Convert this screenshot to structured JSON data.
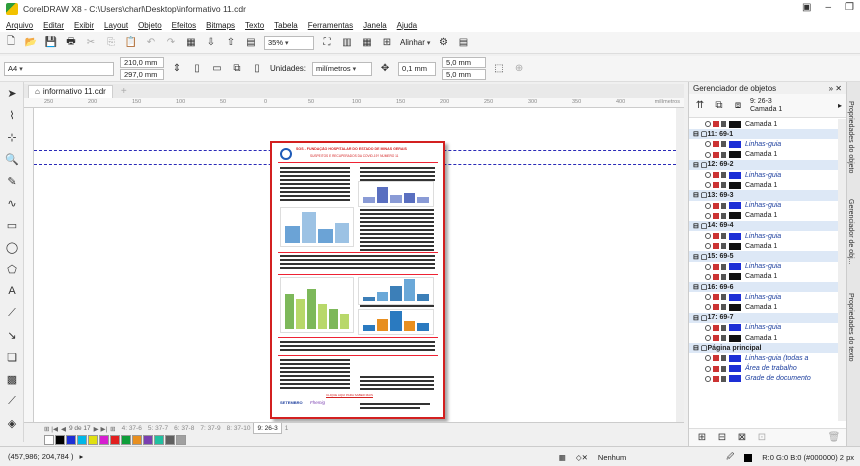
{
  "window": {
    "title": "CorelDRAW X8 - C:\\Users\\charl\\Desktop\\informativo 11.cdr"
  },
  "menu": [
    "Arquivo",
    "Editar",
    "Exibir",
    "Layout",
    "Objeto",
    "Efeitos",
    "Bitmaps",
    "Texto",
    "Tabela",
    "Ferramentas",
    "Janela",
    "Ajuda"
  ],
  "toolbar": {
    "zoom": "35%",
    "align_label": "Alinhar"
  },
  "property_bar": {
    "paper_size": "A4",
    "width": "210,0 mm",
    "height": "297,0 mm",
    "units_label": "Unidades:",
    "units_value": "milímetros",
    "nudge": "0,1 mm",
    "dup_x": "5,0 mm",
    "dup_y": "5,0 mm"
  },
  "document_tab": {
    "name": "informativo 11.cdr"
  },
  "ruler": {
    "ticks": [
      "250",
      "200",
      "150",
      "100",
      "50",
      "0",
      "50",
      "100",
      "150",
      "200",
      "250",
      "300",
      "350",
      "400"
    ],
    "units": "milímetros"
  },
  "page_content": {
    "headline1": "SOS - FUNDAÇÃO HOSPITALAR DO ESTADO DE MINAS GERAIS",
    "headline2": "SUSPEITOS E RECUPERADOS DA COVID-19?   NÚMERO 11",
    "footer_link": "CLIQUE AQUI PARA SABER MAIS",
    "logo1": "SETEMBRO",
    "logo2": "Fhemig"
  },
  "page_nav": {
    "position": "9 de 17",
    "tabs": [
      "4: 37-6",
      "5: 37-7",
      "6: 37-8",
      "7: 37-9",
      "8: 37-10",
      "9: 26-3",
      "1"
    ],
    "active_index": 5
  },
  "palette": [
    "#ffffff",
    "#000000",
    "#1e2fd6",
    "#00b7e8",
    "#e0e010",
    "#d61ed0",
    "#e11f1f",
    "#0f9e3a",
    "#e88f20",
    "#7a3fb0",
    "#20c0a0",
    "#606060",
    "#a0a0a0"
  ],
  "status": {
    "coords": "(457,986; 204,784 )",
    "fill": "Nenhum",
    "outline": "R:0 G:0 B:0 (#000000)  2 px"
  },
  "object_manager": {
    "title": "Gerenciador de objetos",
    "current_page": "9: 26-3",
    "current_layer": "Camada 1",
    "rows": [
      {
        "kind": "layer",
        "label": "Camada 1",
        "color": "#111111"
      },
      {
        "kind": "page",
        "label": "11: 69-1"
      },
      {
        "kind": "guide",
        "label": "Linhas-guia",
        "color": "#1d2fd6"
      },
      {
        "kind": "layer",
        "label": "Camada 1",
        "color": "#111111"
      },
      {
        "kind": "page",
        "label": "12: 69-2"
      },
      {
        "kind": "guide",
        "label": "Linhas-guia",
        "color": "#1d2fd6"
      },
      {
        "kind": "layer",
        "label": "Camada 1",
        "color": "#111111"
      },
      {
        "kind": "page",
        "label": "13: 69-3"
      },
      {
        "kind": "guide",
        "label": "Linhas-guia",
        "color": "#1d2fd6"
      },
      {
        "kind": "layer",
        "label": "Camada 1",
        "color": "#111111"
      },
      {
        "kind": "page",
        "label": "14: 69-4"
      },
      {
        "kind": "guide",
        "label": "Linhas-guia",
        "color": "#1d2fd6"
      },
      {
        "kind": "layer",
        "label": "Camada 1",
        "color": "#111111"
      },
      {
        "kind": "page",
        "label": "15: 69-5"
      },
      {
        "kind": "guide",
        "label": "Linhas-guia",
        "color": "#1d2fd6"
      },
      {
        "kind": "layer",
        "label": "Camada 1",
        "color": "#111111"
      },
      {
        "kind": "page",
        "label": "16: 69-6"
      },
      {
        "kind": "guide",
        "label": "Linhas-guia",
        "color": "#1d2fd6"
      },
      {
        "kind": "layer",
        "label": "Camada 1",
        "color": "#111111"
      },
      {
        "kind": "page",
        "label": "17: 69-7"
      },
      {
        "kind": "guide",
        "label": "Linhas-guia",
        "color": "#1d2fd6"
      },
      {
        "kind": "layer",
        "label": "Camada 1",
        "color": "#111111"
      },
      {
        "kind": "page",
        "label": "Página principal"
      },
      {
        "kind": "guide",
        "label": "Linhas-guia (todas a",
        "color": "#1d2fd6"
      },
      {
        "kind": "guide",
        "label": "Área de trabalho",
        "color": "#1d2fd6"
      },
      {
        "kind": "guide",
        "label": "Grade de documento",
        "color": "#1d2fd6"
      }
    ]
  },
  "dockers": [
    "Propriedades do objeto",
    "Gerenciador de obj...",
    "Propriedades do texto"
  ]
}
